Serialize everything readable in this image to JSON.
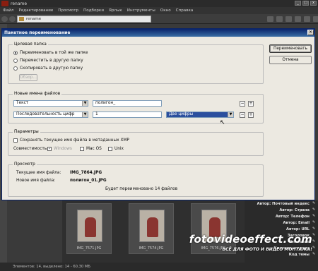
{
  "app": {
    "title": "rename",
    "menu": [
      "Файл",
      "Редактирование",
      "Просмотр",
      "Подборки",
      "Ярлык",
      "Инструменты",
      "Окно",
      "Справка"
    ],
    "path": "rename"
  },
  "dialog": {
    "title": "Пакетное переименование",
    "close_glyph": "✕",
    "target_folder": {
      "label": "Целевая папка",
      "options": [
        "Переименовать в той же папке",
        "Переместить в другую папку",
        "Скопировать в другую папку"
      ],
      "selected_index": 0,
      "browse_label": "Обзор..."
    },
    "buttons": {
      "rename": "Переименовать",
      "cancel": "Отмена"
    },
    "new_names": {
      "label": "Новые имена файлов",
      "row1": {
        "type": "Текст",
        "value": "полигон_"
      },
      "row2": {
        "type": "Последовательность цифр",
        "value": "1",
        "digits": "Две цифры"
      }
    },
    "options": {
      "label": "Параметры",
      "keep_name_label": "Сохранять текущее имя файла в метаданных XMP",
      "compat_label": "Совместимость:",
      "compat_windows": "Windows",
      "compat_macos": "Mac OS",
      "compat_unix": "Unix"
    },
    "preview": {
      "label": "Просмотр",
      "current_label": "Текущее имя файла:",
      "current_value": "IMG_7864.JPG",
      "new_label": "Новое имя файла:",
      "new_value": "полигон_01.JPG",
      "note": "Будет переименовано 14 файлов"
    }
  },
  "thumbnails": [
    "IMG_7571.JPG",
    "IMG_7574.JPG",
    "IMG_7576.JPG"
  ],
  "metadata_rows": [
    "Автор: Почтовый индекс",
    "Автор: Страна",
    "Автор: Телефон",
    "Автор: Email",
    "Автор: URL",
    "Заголовок",
    "Описание",
    "Ключевые слова",
    "Код темы"
  ],
  "status": "Элементов: 14, выделено: 14 - 60,30 МБ",
  "watermark": {
    "site": "fotovideoeffect.com",
    "slogan": "ВСЁ ДЛЯ ФОТО И ВИДЕО МОНТАЖА!"
  },
  "colors": {
    "dialog_bg": "#ece9e1",
    "title_bar": "#0a246a",
    "highlight": "#2b4f9e"
  }
}
